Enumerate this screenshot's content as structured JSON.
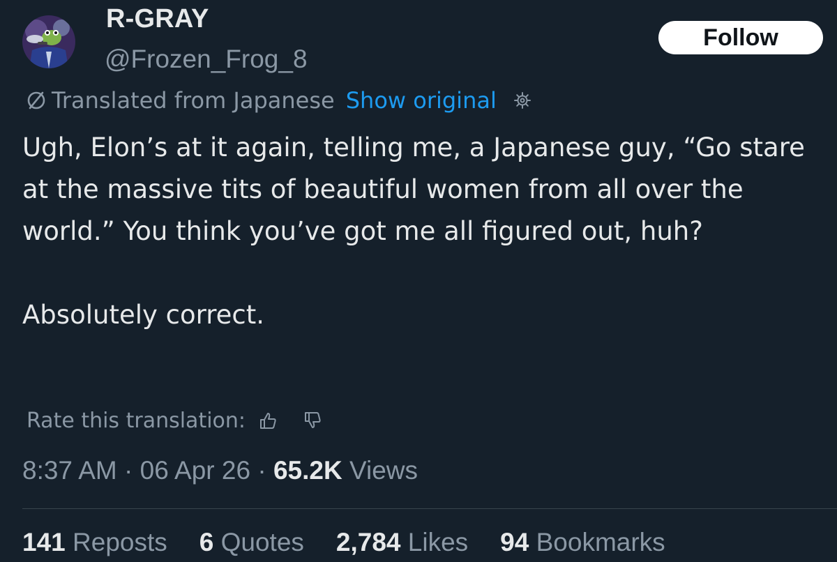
{
  "author": {
    "display_name": "R-GRAY",
    "handle": "@Frozen_Frog_8"
  },
  "follow_button": {
    "label": "Follow"
  },
  "translation": {
    "label": "Translated from Japanese",
    "show_original": "Show original",
    "icon": "translate-icon",
    "settings_icon": "gear-icon"
  },
  "tweet": {
    "paragraphs": [
      "Ugh, Elon’s at it again, telling me, a Japanese guy, “Go stare at the massive tits of beautiful women from all over the world.” You think you’ve got me all figured out, huh?",
      "Absolutely correct."
    ]
  },
  "rate_translation": {
    "label": "Rate this translation:",
    "icons": [
      "thumbs-up-icon",
      "thumbs-down-icon"
    ]
  },
  "meta": {
    "time": "8:37 AM",
    "separator": "·",
    "date": "06 Apr 26",
    "views_count": "65.2K",
    "views_label": "Views"
  },
  "stats": [
    {
      "count": "141",
      "label": "Reposts"
    },
    {
      "count": "6",
      "label": "Quotes"
    },
    {
      "count": "2,784",
      "label": "Likes"
    },
    {
      "count": "94",
      "label": "Bookmarks"
    }
  ],
  "colors": {
    "background": "#15202b",
    "primary_text": "#e7e9ea",
    "secondary_text": "#8b98a5",
    "link": "#1d9bf0",
    "button_bg": "#ffffff"
  }
}
